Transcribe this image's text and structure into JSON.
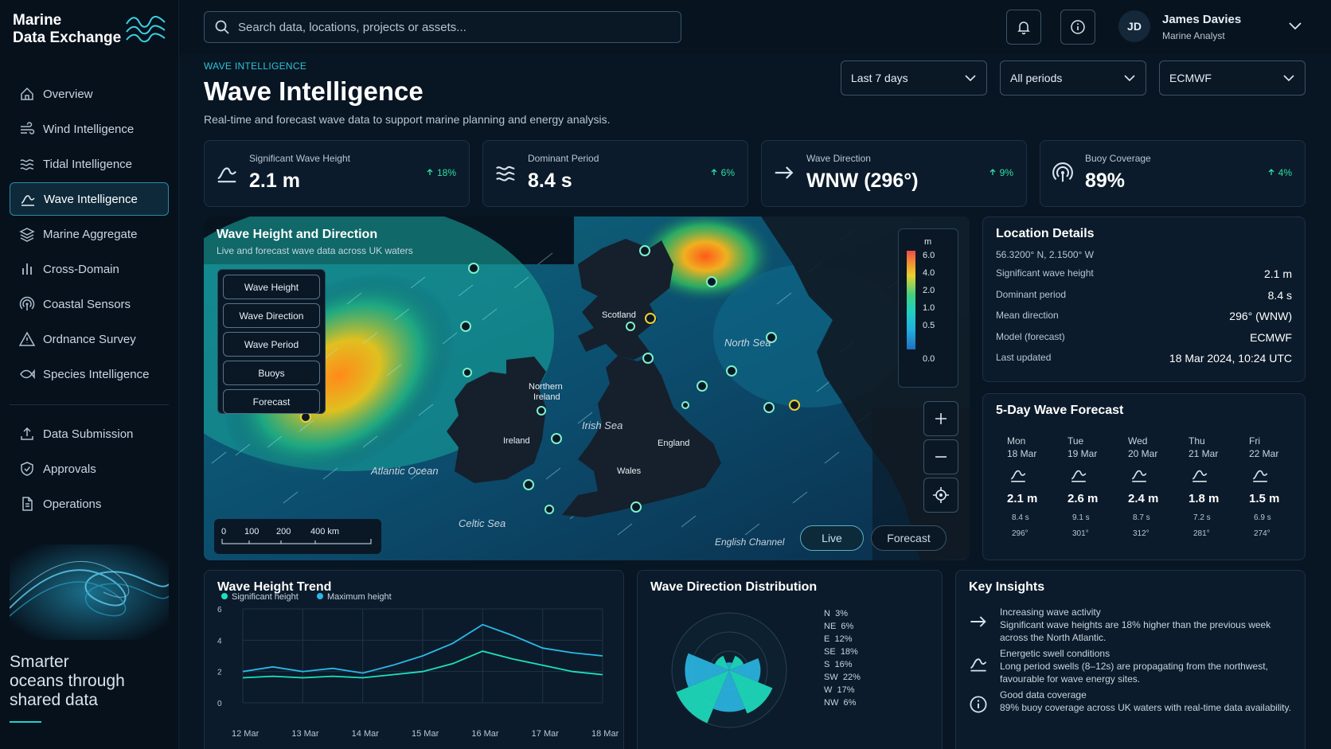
{
  "brand": {
    "line1": "Marine",
    "line2": "Data Exchange"
  },
  "nav": [
    {
      "label": "Overview",
      "icon": "home-icon"
    },
    {
      "label": "Wind Intelligence",
      "icon": "wind-icon"
    },
    {
      "label": "Tidal Intelligence",
      "icon": "tide-icon"
    },
    {
      "label": "Wave Intelligence",
      "icon": "wave-icon",
      "active": true
    },
    {
      "label": "Marine Aggregate",
      "icon": "layers-icon"
    },
    {
      "label": "Cross-Domain",
      "icon": "bars-icon"
    },
    {
      "label": "Coastal Sensors",
      "icon": "signal-icon"
    },
    {
      "label": "Ordnance Survey",
      "icon": "warning-icon"
    },
    {
      "label": "Species Intelligence",
      "icon": "fish-icon"
    }
  ],
  "nav2": [
    {
      "label": "Data Submission",
      "icon": "upload-icon"
    },
    {
      "label": "Approvals",
      "icon": "shield-check-icon"
    },
    {
      "label": "Operations",
      "icon": "document-icon"
    }
  ],
  "tagline": {
    "l1": "Smarter",
    "l2": "oceans through",
    "l3": "shared data"
  },
  "search": {
    "placeholder": "Search data, locations, projects or assets..."
  },
  "user": {
    "initials": "JD",
    "name": "James Davies",
    "role": "Marine Analyst"
  },
  "page": {
    "eyebrow": "WAVE INTELLIGENCE",
    "title": "Wave Intelligence",
    "subtitle": "Real-time and forecast wave data to support marine planning and energy analysis."
  },
  "filters": {
    "range": "Last 7 days",
    "period": "All periods",
    "model": "ECMWF"
  },
  "kpis": [
    {
      "label": "Significant Wave Height",
      "value": "2.1 m",
      "delta": "18%",
      "icon": "wave-icon"
    },
    {
      "label": "Dominant Period",
      "value": "8.4 s",
      "delta": "6%",
      "icon": "waves-icon"
    },
    {
      "label": "Wave Direction",
      "value": "WNW (296°)",
      "delta": "9%",
      "icon": "arrow-right-icon"
    },
    {
      "label": "Buoy Coverage",
      "value": "89%",
      "delta": "4%",
      "icon": "signal-icon"
    }
  ],
  "map": {
    "title": "Wave Height and Direction",
    "subtitle": "Live and forecast wave data across UK waters",
    "layers": [
      "Wave Height",
      "Wave Direction",
      "Wave Period",
      "Buoys",
      "Forecast"
    ],
    "legend_unit": "m",
    "legend_ticks": [
      "6.0",
      "4.0",
      "2.0",
      "1.0",
      "0.5",
      "0.0"
    ],
    "labels": {
      "scotland": "Scotland",
      "ni1": "Northern",
      "ni2": "Ireland",
      "ireland": "Ireland",
      "england": "England",
      "wales": "Wales"
    },
    "seas": {
      "north": "North Sea",
      "irish": "Irish Sea",
      "atlantic": "Atlantic Ocean",
      "celtic": "Celtic Sea",
      "channel": "English Channel"
    },
    "scale": [
      "0",
      "100",
      "200",
      "400 km"
    ],
    "toggle": {
      "live": "Live",
      "forecast": "Forecast"
    }
  },
  "location": {
    "title": "Location Details",
    "coords": "56.3200° N, 2.1500° W",
    "rows": [
      {
        "k": "Significant wave height",
        "v": "2.1 m"
      },
      {
        "k": "Dominant period",
        "v": "8.4 s"
      },
      {
        "k": "Mean direction",
        "v": "296° (WNW)"
      },
      {
        "k": "Model (forecast)",
        "v": "ECMWF"
      },
      {
        "k": "Last updated",
        "v": "18 Mar 2024, 10:24 UTC"
      }
    ]
  },
  "forecast": {
    "title": "5-Day Wave Forecast",
    "days": [
      {
        "day": "Mon",
        "date": "18 Mar",
        "h": "2.1 m",
        "p": "8.4 s",
        "d": "296°"
      },
      {
        "day": "Tue",
        "date": "19 Mar",
        "h": "2.6 m",
        "p": "9.1 s",
        "d": "301°"
      },
      {
        "day": "Wed",
        "date": "20 Mar",
        "h": "2.4 m",
        "p": "8.7 s",
        "d": "312°"
      },
      {
        "day": "Thu",
        "date": "21 Mar",
        "h": "1.8 m",
        "p": "7.2 s",
        "d": "281°"
      },
      {
        "day": "Fri",
        "date": "22 Mar",
        "h": "1.5 m",
        "p": "6.9 s",
        "d": "274°"
      }
    ]
  },
  "trend": {
    "title": "Wave Height Trend"
  },
  "direction": {
    "title": "Wave Direction Distribution",
    "items": [
      {
        "dir": "N",
        "pct": "3%",
        "v": 3
      },
      {
        "dir": "NE",
        "pct": "6%",
        "v": 6
      },
      {
        "dir": "E",
        "pct": "12%",
        "v": 12
      },
      {
        "dir": "SE",
        "pct": "18%",
        "v": 18
      },
      {
        "dir": "S",
        "pct": "16%",
        "v": 16
      },
      {
        "dir": "SW",
        "pct": "22%",
        "v": 22
      },
      {
        "dir": "W",
        "pct": "17%",
        "v": 17
      },
      {
        "dir": "NW",
        "pct": "6%",
        "v": 6
      }
    ]
  },
  "insights": {
    "title": "Key Insights",
    "items": [
      {
        "title": "Increasing wave activity",
        "body": "Significant wave heights are 18% higher than the previous week across the North Atlantic."
      },
      {
        "title": "Energetic swell conditions",
        "body": "Long period swells (8–12s) are propagating from the northwest, favourable for wave energy sites."
      },
      {
        "title": "Good data coverage",
        "body": "89% buoy coverage across UK waters with real-time data availability."
      }
    ]
  },
  "colors": {
    "accent": "#2ec4d6",
    "positive": "#2fe0a6",
    "series_sig": "#1ee0c0",
    "series_max": "#2bb8e6"
  },
  "chart_data": {
    "type": "line",
    "title": "Wave Height Trend",
    "x_ticks": [
      "12 Mar",
      "13 Mar",
      "14 Mar",
      "15 Mar",
      "16 Mar",
      "17 Mar",
      "18 Mar"
    ],
    "y_ticks": [
      "0",
      "2",
      "4",
      "6"
    ],
    "ylim": [
      0,
      6
    ],
    "xlabel": "",
    "ylabel": "",
    "legend": "top-left",
    "grid": true,
    "x": [
      0,
      0.5,
      1,
      1.5,
      2,
      2.5,
      3,
      3.5,
      4,
      4.5,
      5,
      5.5,
      6
    ],
    "series": [
      {
        "name": "Significant height",
        "color": "#1ee0c0",
        "values": [
          1.6,
          1.7,
          1.6,
          1.7,
          1.6,
          1.8,
          2.0,
          2.5,
          3.3,
          2.8,
          2.4,
          2.0,
          1.8
        ]
      },
      {
        "name": "Maximum height",
        "color": "#2bb8e6",
        "values": [
          2.0,
          2.3,
          2.0,
          2.2,
          1.9,
          2.4,
          3.0,
          3.8,
          5.0,
          4.3,
          3.5,
          3.2,
          3.0
        ]
      }
    ]
  }
}
